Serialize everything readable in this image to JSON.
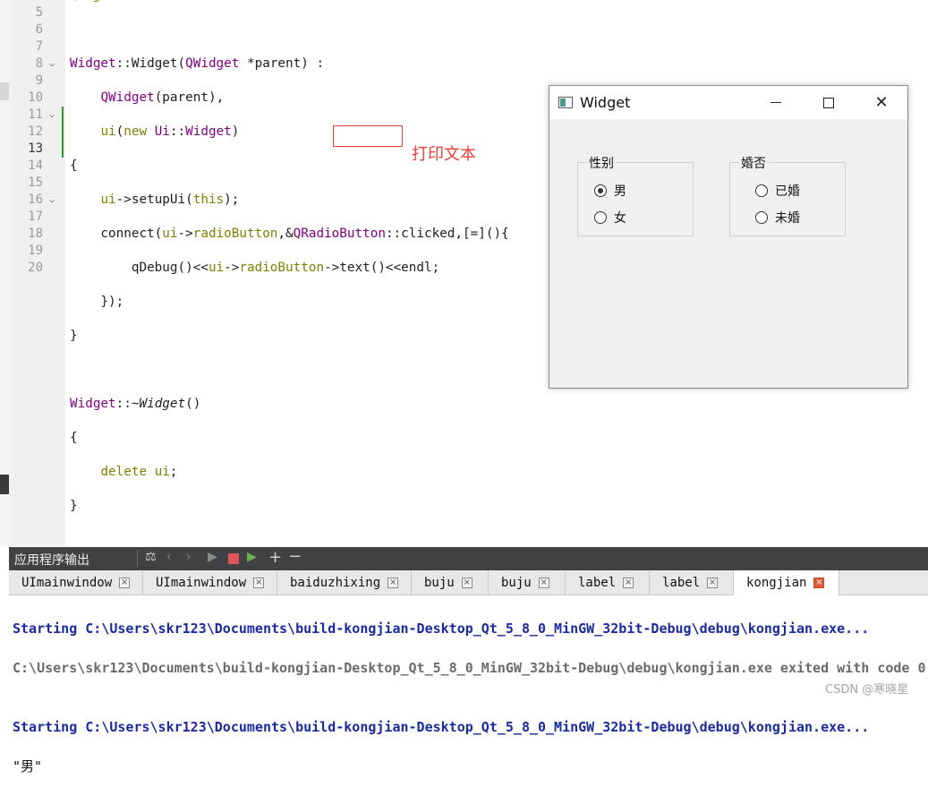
{
  "editor": {
    "line_numbers": [
      "5",
      "6",
      "7",
      "8",
      "9",
      "10",
      "11",
      "12",
      "13",
      "14",
      "15",
      "16",
      "17",
      "18",
      "19",
      "20"
    ],
    "annotation": "打印文本"
  },
  "window": {
    "title": "Widget",
    "close_glyph": "✕",
    "gender_group": {
      "title": "性别",
      "options": [
        "男",
        "女"
      ],
      "selected": "男"
    },
    "marriage_group": {
      "title": "婚否",
      "options": [
        "已婚",
        "未婚"
      ],
      "selected": ""
    }
  },
  "output_pane": {
    "title": "应用程序输出",
    "tabs": [
      {
        "label": "UImainwindow"
      },
      {
        "label": "UImainwindow"
      },
      {
        "label": "baiduzhixing"
      },
      {
        "label": "buju"
      },
      {
        "label": "buju"
      },
      {
        "label": "label"
      },
      {
        "label": "label"
      },
      {
        "label": "kongjian"
      }
    ],
    "active_tab": "kongjian",
    "lines": [
      "Starting C:\\Users\\skr123\\Documents\\build-kongjian-Desktop_Qt_5_8_0_MinGW_32bit-Debug\\debug\\kongjian.exe...",
      "C:\\Users\\skr123\\Documents\\build-kongjian-Desktop_Qt_5_8_0_MinGW_32bit-Debug\\debug\\kongjian.exe exited with code 0",
      "",
      "Starting C:\\Users\\skr123\\Documents\\build-kongjian-Desktop_Qt_5_8_0_MinGW_32bit-Debug\\debug\\kongjian.exe...",
      "\"男\""
    ]
  },
  "watermark": "CSDN @寒晓星"
}
